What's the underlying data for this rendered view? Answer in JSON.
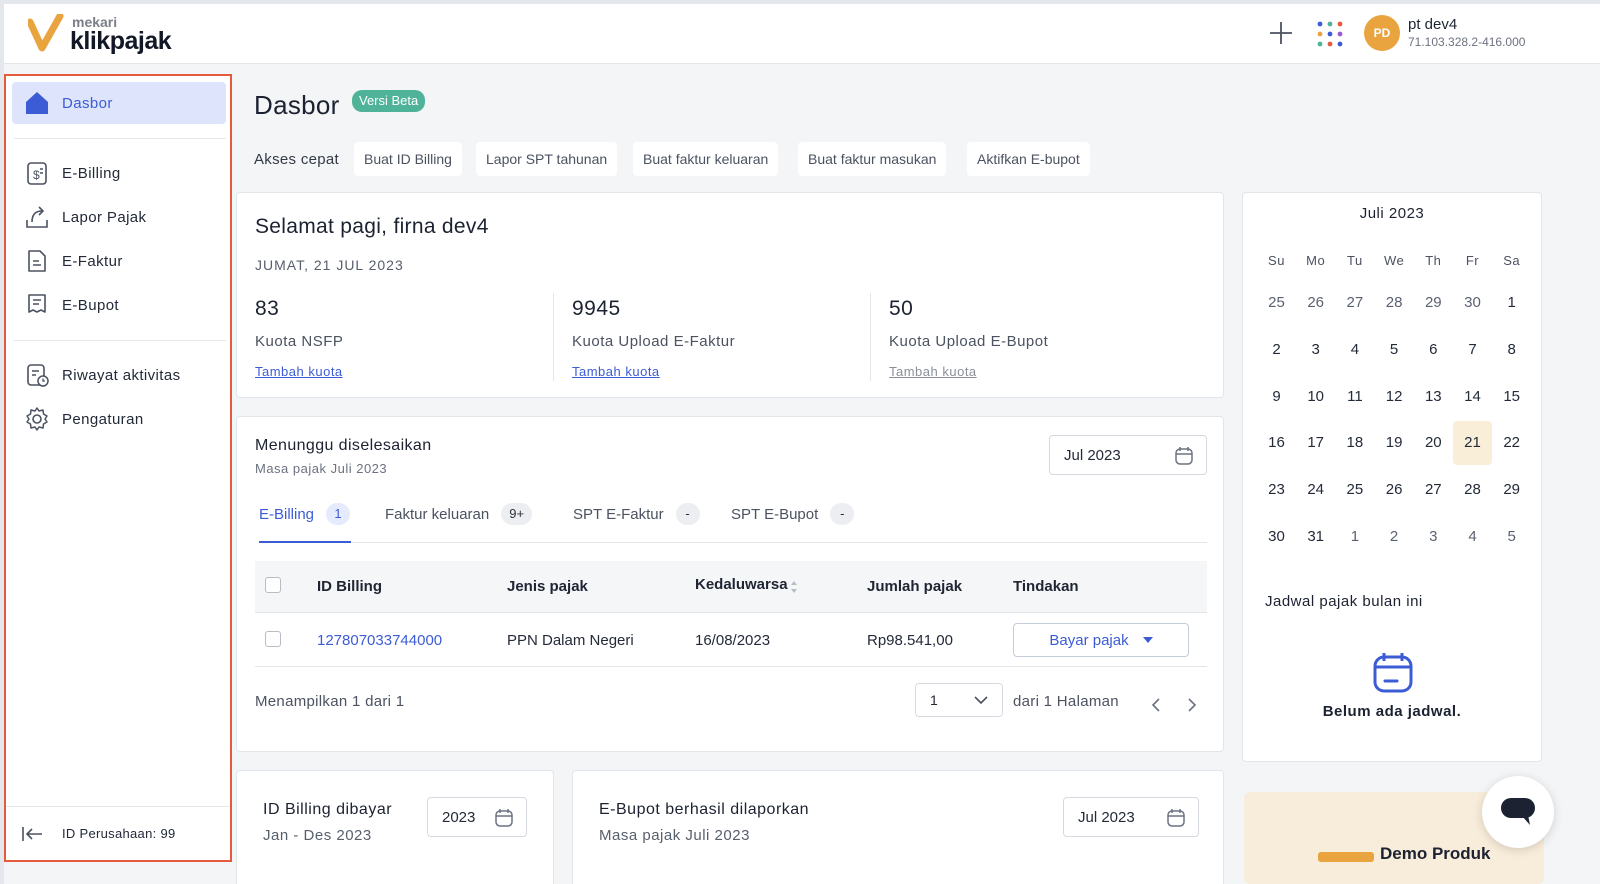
{
  "brand": {
    "top": "mekari",
    "main": "klikpajak"
  },
  "header": {
    "avatar_initials": "PD",
    "company_name": "pt dev4",
    "company_npwp": "71.103.328.2-416.000"
  },
  "sidebar": {
    "items": [
      {
        "label": "Dasbor",
        "icon": "home-icon",
        "active": true
      },
      {
        "label": "E-Billing",
        "icon": "billing-icon"
      },
      {
        "label": "Lapor Pajak",
        "icon": "upload-report-icon"
      },
      {
        "label": "E-Faktur",
        "icon": "document-icon"
      },
      {
        "label": "E-Bupot",
        "icon": "receipt-icon"
      },
      {
        "label": "Riwayat aktivitas",
        "icon": "activity-history-icon"
      },
      {
        "label": "Pengaturan",
        "icon": "gear-icon"
      }
    ],
    "company_id": "ID Perusahaan: 99"
  },
  "page": {
    "title": "Dasbor",
    "badge": "Versi Beta"
  },
  "quick_access": {
    "label": "Akses cepat",
    "buttons": [
      "Buat ID Billing",
      "Lapor SPT tahunan",
      "Buat faktur keluaran",
      "Buat faktur masukan",
      "Aktifkan E-bupot"
    ]
  },
  "greeting": {
    "title": "Selamat pagi, firna dev4",
    "date": "JUMAT, 21 JUL 2023",
    "stats": [
      {
        "value": "83",
        "label": "Kuota NSFP",
        "link": "Tambah kuota"
      },
      {
        "value": "9945",
        "label": "Kuota Upload E-Faktur",
        "link": "Tambah kuota"
      },
      {
        "value": "50",
        "label": "Kuota Upload E-Bupot",
        "link": "Tambah kuota"
      }
    ]
  },
  "pending": {
    "title": "Menunggu diselesaikan",
    "subtitle": "Masa pajak Juli 2023",
    "period": "Jul 2023",
    "tabs": [
      {
        "label": "E-Billing",
        "badge": "1",
        "active": true
      },
      {
        "label": "Faktur keluaran",
        "badge": "9+"
      },
      {
        "label": "SPT E-Faktur",
        "badge": "-"
      },
      {
        "label": "SPT E-Bupot",
        "badge": "-"
      }
    ],
    "table": {
      "columns": [
        "ID Billing",
        "Jenis pajak",
        "Kedaluwarsa",
        "Jumlah pajak",
        "Tindakan"
      ],
      "rows": [
        {
          "id": "127807033744000",
          "type": "PPN Dalam Negeri",
          "expiry": "16/08/2023",
          "amount": "Rp98.541,00",
          "action": "Bayar pajak"
        }
      ]
    },
    "showing": "Menampilkan 1 dari 1",
    "page_value": "1",
    "page_total": "dari 1 Halaman"
  },
  "calendar": {
    "title": "Juli 2023",
    "dow": [
      "Su",
      "Mo",
      "Tu",
      "We",
      "Th",
      "Fr",
      "Sa"
    ],
    "weeks": [
      [
        "25",
        "26",
        "27",
        "28",
        "29",
        "30",
        "1"
      ],
      [
        "2",
        "3",
        "4",
        "5",
        "6",
        "7",
        "8"
      ],
      [
        "9",
        "10",
        "11",
        "12",
        "13",
        "14",
        "15"
      ],
      [
        "16",
        "17",
        "18",
        "19",
        "20",
        "21",
        "22"
      ],
      [
        "23",
        "24",
        "25",
        "26",
        "27",
        "28",
        "29"
      ],
      [
        "30",
        "31",
        "1",
        "2",
        "3",
        "4",
        "5"
      ]
    ],
    "today": "21",
    "schedule_title": "Jadwal pajak bulan ini",
    "empty_text": "Belum ada jadwal."
  },
  "paid_billing": {
    "title": "ID Billing dibayar",
    "subtitle": "Jan - Des 2023",
    "year": "2023"
  },
  "ebupot_reported": {
    "title": "E-Bupot berhasil dilaporkan",
    "subtitle": "Masa pajak Juli 2023",
    "period": "Jul 2023"
  },
  "promo": {
    "text": "Demo Produk"
  },
  "colors": {
    "primary": "#3c5cd6",
    "accent": "#e9a43f",
    "beta": "#4fb39a",
    "highlight": "#e35a3d"
  }
}
